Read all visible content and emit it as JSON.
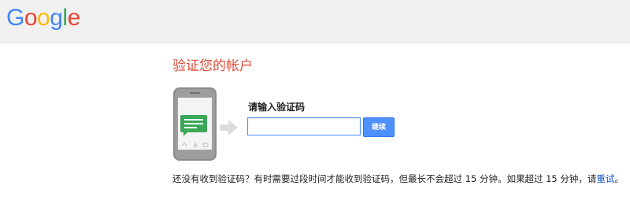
{
  "header": {
    "logo_letters": [
      {
        "char": "G",
        "color": "#4285f4"
      },
      {
        "char": "o",
        "color": "#ea4335"
      },
      {
        "char": "o",
        "color": "#fbbc05"
      },
      {
        "char": "g",
        "color": "#4285f4"
      },
      {
        "char": "l",
        "color": "#34a853"
      },
      {
        "char": "e",
        "color": "#ea4335"
      }
    ]
  },
  "main": {
    "title": "验证您的帐户",
    "code_label": "请输入验证码",
    "code_input": {
      "value": "",
      "placeholder": ""
    },
    "continue_label": "继续",
    "help_text": "还没有收到验证码？有时需要过段时间才能收到验证码，但最长不会超过 15 分钟。如果超过 15 分钟，请",
    "retry_link": "重试",
    "help_suffix": "。"
  },
  "colors": {
    "title": "#dd4b39",
    "button": "#4d90fe",
    "link": "#1155cc",
    "header_bg": "#f1f1f1",
    "sms_bubble": "#3aa757"
  },
  "icons": {
    "phone": "phone-icon",
    "sms": "sms-bubble-icon",
    "arrow": "arrow-right-icon"
  }
}
